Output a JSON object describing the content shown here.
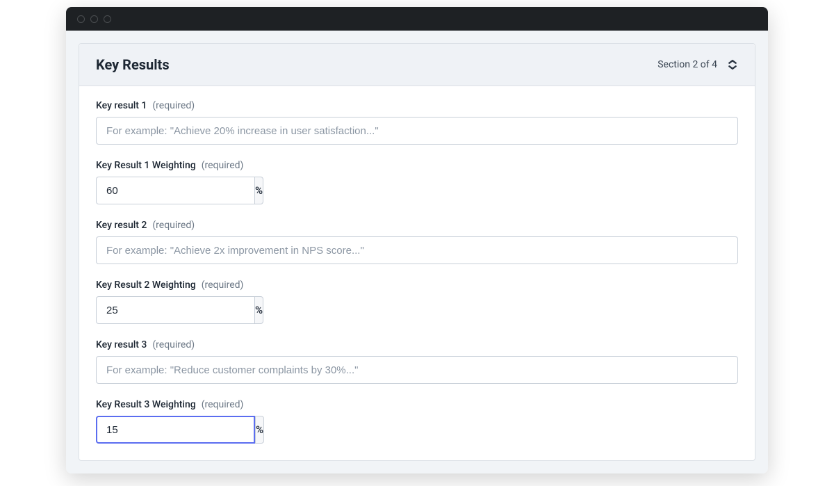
{
  "header": {
    "title": "Key Results",
    "section_indicator": "Section 2 of 4"
  },
  "fields": {
    "kr1": {
      "label": "Key result 1",
      "required": "(required)",
      "placeholder": "For example: \"Achieve 20% increase in user satisfaction...\"",
      "value": ""
    },
    "kr1w": {
      "label": "Key Result 1 Weighting",
      "required": "(required)",
      "value": "60",
      "suffix": "%"
    },
    "kr2": {
      "label": "Key result 2",
      "required": "(required)",
      "placeholder": "For example: \"Achieve 2x improvement in NPS score...\"",
      "value": ""
    },
    "kr2w": {
      "label": "Key Result 2 Weighting",
      "required": "(required)",
      "value": "25",
      "suffix": "%"
    },
    "kr3": {
      "label": "Key result 3",
      "required": "(required)",
      "placeholder": "For example: \"Reduce customer complaints by 30%...\"",
      "value": ""
    },
    "kr3w": {
      "label": "Key Result 3 Weighting",
      "required": "(required)",
      "value": "15",
      "suffix": "%"
    }
  }
}
